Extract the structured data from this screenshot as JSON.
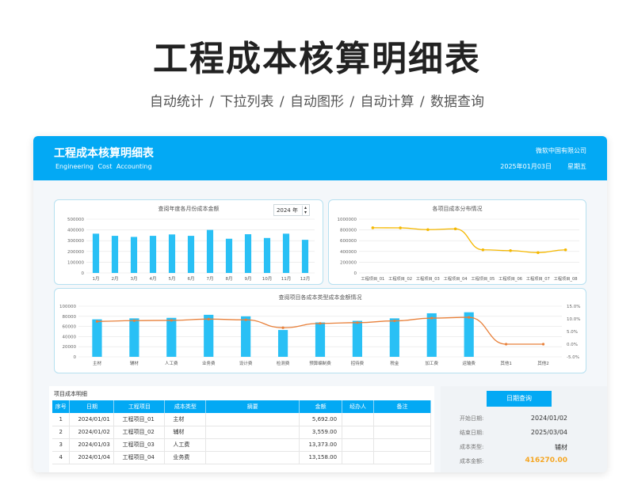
{
  "hero": {
    "title": "工程成本核算明细表",
    "subtitle": "自动统计  /  下拉列表  /  自动图形   /  自动计算   /  数据查询"
  },
  "header": {
    "title": "工程成本核算明细表",
    "subtitle": "Engineering  Cost  Accounting",
    "company": "微软中国有限公司",
    "date": "2025年01月03日",
    "weekday": "星期五"
  },
  "colors": {
    "accent": "#03a9f4",
    "bar": "#29c0f5",
    "line": "#f5b800",
    "trend": "#e8803a",
    "amount": "#f5a623"
  },
  "year_selector": {
    "value": "2024 年"
  },
  "chart_data": [
    {
      "type": "bar",
      "title": "查阅年度各月份成本金额",
      "categories": [
        "1月",
        "2月",
        "3月",
        "4月",
        "5月",
        "6月",
        "7月",
        "8月",
        "9月",
        "10月",
        "11月",
        "12月"
      ],
      "values": [
        365000,
        345000,
        335000,
        345000,
        358000,
        345000,
        400000,
        318000,
        360000,
        325000,
        365000,
        308000
      ],
      "ylim": [
        0,
        500000
      ],
      "yticks": [
        "0",
        "100000",
        "200000",
        "300000",
        "400000",
        "500000"
      ],
      "grid": true
    },
    {
      "type": "line",
      "title": "各项目成本分布情况",
      "categories": [
        "工程项目_01",
        "工程项目_02",
        "工程项目_03",
        "工程项目_04",
        "工程项目_05",
        "工程项目_06",
        "工程项目_07",
        "工程项目_08"
      ],
      "values": [
        840000,
        838000,
        805000,
        820000,
        430000,
        415000,
        378000,
        430000
      ],
      "ylim": [
        0,
        1000000
      ],
      "yticks": [
        "0",
        "200000",
        "400000",
        "600000",
        "800000",
        "1000000"
      ],
      "grid": true
    },
    {
      "type": "bar",
      "title": "查阅项目各成本类型成本金额情况",
      "categories": [
        "主材",
        "辅材",
        "人工费",
        "业务费",
        "设计费",
        "检测费",
        "预算编制费",
        "招待费",
        "税金",
        "加工费",
        "运输费",
        "其他1",
        "其他2"
      ],
      "values": [
        74000,
        76000,
        77000,
        83000,
        80000,
        53000,
        68000,
        71000,
        76000,
        86000,
        88000,
        0,
        0
      ],
      "ylim": [
        0,
        100000
      ],
      "yticks": [
        "0",
        "20000",
        "40000",
        "60000",
        "80000",
        "100000"
      ],
      "series": [
        {
          "values": [
            74000,
            76000,
            77000,
            83000,
            80000,
            53000,
            68000,
            71000,
            76000,
            86000,
            88000,
            0,
            0
          ]
        },
        {
          "axis": "right",
          "values": [
            9.0,
            9.3,
            9.4,
            9.9,
            9.6,
            6.5,
            8.2,
            8.5,
            9.2,
            10.3,
            10.6,
            0.0,
            0.0
          ]
        }
      ],
      "y2lim": [
        -5,
        15
      ],
      "y2ticks": [
        "-5.0%",
        "0.0%",
        "5.0%",
        "10.0%",
        "15.0%"
      ],
      "grid": true
    }
  ],
  "detail": {
    "caption": "项目成本明细",
    "columns": [
      "序号",
      "日期",
      "工程项目",
      "成本类型",
      "摘要",
      "金额",
      "经办人",
      "备注"
    ],
    "rows": [
      [
        "1",
        "2024/01/01",
        "工程项目_01",
        "主材",
        "",
        "5,692.00",
        "",
        ""
      ],
      [
        "2",
        "2024/01/02",
        "工程项目_02",
        "辅材",
        "",
        "3,559.00",
        "",
        ""
      ],
      [
        "3",
        "2024/01/03",
        "工程项目_03",
        "人工费",
        "",
        "13,373.00",
        "",
        ""
      ],
      [
        "4",
        "2024/01/04",
        "工程项目_04",
        "业务费",
        "",
        "13,158.00",
        "",
        ""
      ]
    ]
  },
  "query": {
    "button": "日期查询",
    "items": [
      {
        "label": "开始日期:",
        "value": "2024/01/02"
      },
      {
        "label": "结束日期:",
        "value": "2025/03/04"
      },
      {
        "label": "成本类型:",
        "value": "辅材"
      },
      {
        "label": "成本金额:",
        "value": "416270.00"
      }
    ]
  }
}
